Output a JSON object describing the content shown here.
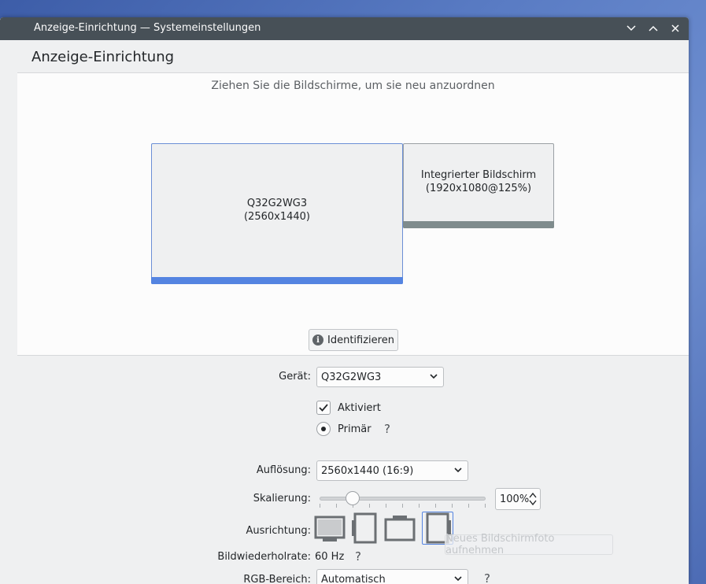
{
  "window": {
    "title": "Anzeige-Einrichtung — Systemeinstellungen",
    "controls": {
      "minimize": "⌄",
      "maximize": "⌃",
      "close": "✕"
    }
  },
  "header": {
    "title": "Anzeige-Einrichtung"
  },
  "arrangement": {
    "hint": "Ziehen Sie die Bildschirme, um sie neu anzuordnen",
    "screens": [
      {
        "name": "Q32G2WG3",
        "detail": "(2560x1440)",
        "primary": true
      },
      {
        "name": "Integrierter Bildschirm",
        "detail": "(1920x1080@125%)",
        "primary": false
      }
    ],
    "identify_label": "Identifizieren"
  },
  "settings": {
    "device_label": "Gerät:",
    "device_value": "Q32G2WG3",
    "enabled_label": "Aktiviert",
    "primary_label": "Primär",
    "help_symbol": "?",
    "resolution_label": "Auflösung:",
    "resolution_value": "2560x1440 (16:9)",
    "scale_label": "Skalierung:",
    "scale_value": "100%",
    "scale_level": 0.2,
    "orientation_label": "Ausrichtung:",
    "refresh_label": "Bildwiederholrate:",
    "refresh_value": "60 Hz",
    "rgb_label": "RGB-Bereich:",
    "rgb_value": "Automatisch",
    "tooltip": "Neues Bildschirmfoto aufnehmen"
  },
  "colors": {
    "accent": "#5484e1",
    "titlebar": "#475057",
    "secondary_bar": "#7f8c8d"
  }
}
